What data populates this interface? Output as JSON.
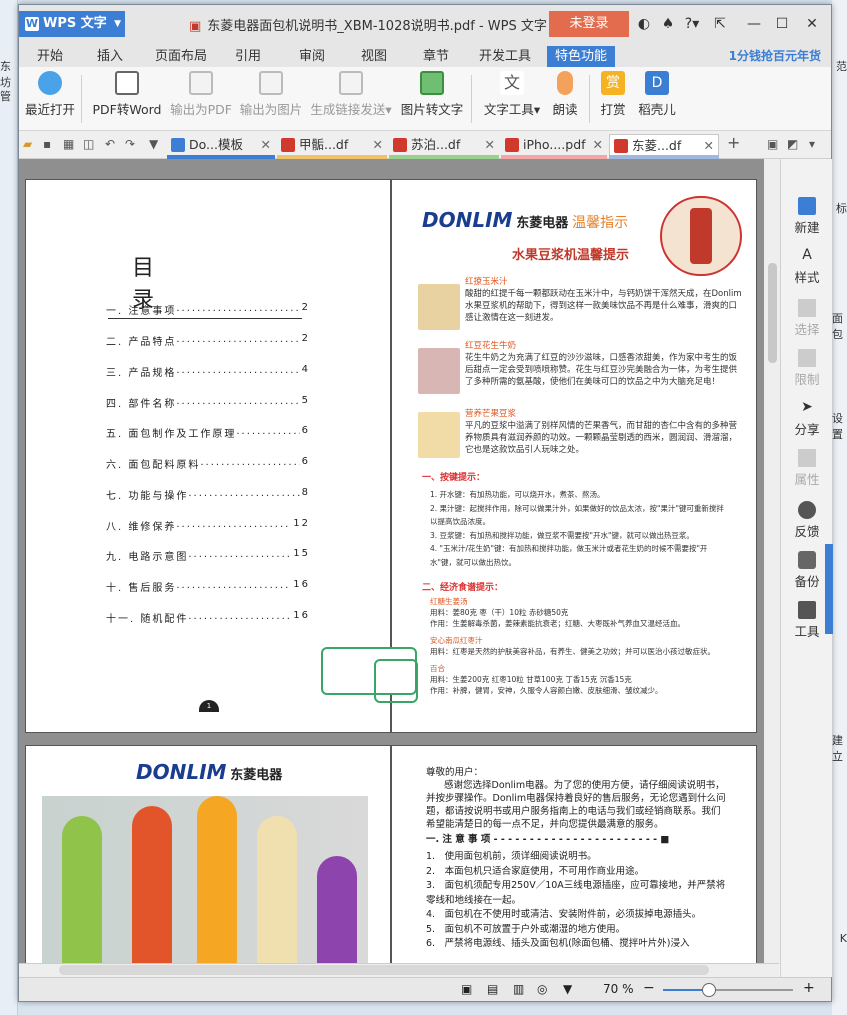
{
  "background": {
    "left_snippets": [
      "东坊",
      "管"
    ],
    "right_snippets": [
      "范",
      "标",
      "面包",
      "设置",
      "建立",
      "K"
    ]
  },
  "app": {
    "logo": "WPS 文字",
    "title": "东菱电器面包机说明书_XBM-1028说明书.pdf - WPS 文字",
    "login": "未登录",
    "help": "?"
  },
  "menu": {
    "items": [
      "开始",
      "插入",
      "页面布局",
      "引用",
      "审阅",
      "视图",
      "章节",
      "开发工具",
      "特色功能"
    ],
    "active": "特色功能",
    "promo": "1分钱抢百元年货"
  },
  "ribbon": {
    "buttons": [
      {
        "label": "最近打开",
        "icon": "cloud-icon",
        "enabled": true
      },
      {
        "label": "PDF转Word",
        "icon": "pdf-to-word-icon",
        "enabled": true
      },
      {
        "label": "输出为PDF",
        "icon": "export-pdf-icon",
        "enabled": false
      },
      {
        "label": "输出为图片",
        "icon": "export-image-icon",
        "enabled": false
      },
      {
        "label": "生成链接发送",
        "icon": "share-link-icon",
        "enabled": false
      },
      {
        "label": "图片转文字",
        "icon": "image-to-text-icon",
        "enabled": true
      },
      {
        "label": "文字工具",
        "icon": "text-tool-icon",
        "enabled": true
      },
      {
        "label": "朗读",
        "icon": "microphone-icon",
        "enabled": true
      },
      {
        "label": "打赏",
        "icon": "reward-icon",
        "enabled": true
      },
      {
        "label": "稻壳儿",
        "icon": "docer-icon",
        "enabled": true
      }
    ],
    "reward_glyph": "赏"
  },
  "tabs": {
    "items": [
      {
        "label": "Do...模板",
        "color": "#3b7ed4"
      },
      {
        "label": "甲骺...df",
        "color": "#f0c36b"
      },
      {
        "label": "苏泊...df",
        "color": "#9ad18f"
      },
      {
        "label": "iPho....pdf",
        "color": "#f2a6a6"
      },
      {
        "label": "东菱...df",
        "color": "#9fb8e0"
      }
    ],
    "active": 4,
    "add": "+"
  },
  "page_left_top": {
    "toc_title": "目　录",
    "toc": [
      {
        "num": "一.",
        "title": "注意事项",
        "page": "2"
      },
      {
        "num": "二.",
        "title": "产品特点",
        "page": "2"
      },
      {
        "num": "三.",
        "title": "产品规格",
        "page": "4"
      },
      {
        "num": "四.",
        "title": "部件名称",
        "page": "5"
      },
      {
        "num": "五.",
        "title": "面包制作及工作原理",
        "page": "6"
      },
      {
        "num": "六.",
        "title": "面包配料原料",
        "page": "6"
      },
      {
        "num": "七.",
        "title": "功能与操作",
        "page": "8"
      },
      {
        "num": "八.",
        "title": "维修保养",
        "page": "12"
      },
      {
        "num": "九.",
        "title": "电路示意图",
        "page": "15"
      },
      {
        "num": "十.",
        "title": "售后服务",
        "page": "16"
      },
      {
        "num": "十一.",
        "title": "随机配件",
        "page": "16"
      }
    ],
    "page_number": "1"
  },
  "page_right_top": {
    "brand": "DONLIM",
    "brand_cn": "东菱电器",
    "tagline": "温馨指示",
    "heading": "水果豆浆机温馨提示",
    "items": [
      {
        "title": "红撩玉米汁",
        "text": "酸甜的红提千每一颗都跃动在玉米汁中，与钙奶饼干浑然天成，在Donlim水果豆浆机的帮助下，得到这样一款美味饮品不再是什么难事，滑爽的口感让激情在这一刻进发。"
      },
      {
        "title": "红豆花生牛奶",
        "text": "花生牛奶之为充满了红豆的沙沙滋味，口感香浓甜美，作为家中考生的饭后甜点一定会受到喷喷称赞。花生与红豆沙完美融合为一体，为考生提供了多种所需的氨基酸，使他们在美味可口的饮品之中为大脑充足电！"
      },
      {
        "title": "营养芒果豆浆",
        "text": "平凡的豆浆中溢满了别样风情的芒果香气，而甘甜的杏仁中含有的多种营养物质具有滋润养颜的功效。一颗颗晶莹剔透的西米，圆润润、滑溜溜，它也是这款饮品引人玩味之处。"
      }
    ],
    "sec1": "一、按键提示：",
    "keys": [
      "1. 开水键：有加热功能，可以烧开水，煮茶、熬汤。",
      "2. 果汁键：起搅拌作用，除可以做果汁外，如果做好的饮品太浓，按\"果汁\"键可重新搅拌以提高饮品浓度。",
      "3. 豆浆键：有加热和搅拌功能，做豆浆不需要按\"开水\"键，就可以做出热豆浆。",
      "4. \"玉米汁/花生奶\"键：有加热和搅拌功能，做玉米汁或者花生奶的时候不需要按\"开水\"键，就可以做出热饮。"
    ],
    "sec2": "二、经济食谱提示：",
    "recipes": [
      {
        "title": "红糖生姜汤",
        "lines": [
          "用料：姜80克 枣（干）10粒 赤砂糖50克",
          "作用：生姜解毒杀菌，姜辣素能抗衰老；红糖、大枣既补气养血又温经活血。"
        ]
      },
      {
        "title": "安心南瓜红枣汁",
        "lines": [
          "用料：红枣是天然的护肤美容补品，有养生、健美之功效；并可以医治小孩过敏症状。"
        ]
      },
      {
        "title": "百合",
        "lines": [
          "用料：生姜200克 红枣10粒 甘草100克 丁香15克 沉香15克",
          "作用：补脾，健胃，安神，久服令人容颜白嫩、皮肤细滑、皱纹减少。"
        ]
      }
    ]
  },
  "page_left_bottom": {
    "brand": "DONLIM",
    "brand_cn": "东菱电器"
  },
  "page_right_bottom": {
    "greeting": "尊敬的用户：",
    "intro": "感谢您选择Donlim电器。为了您的使用方便，请仔细阅读说明书，并按步骤操作。Donlim电器保持着良好的售后服务，无论您遇到什么问题，都请按说明书或用户服务指南上的电话与我们或经销商联系。我们希望能清楚日的每一点不足，并向您提供最满意的服务。",
    "section": "一. 注 意 事 项",
    "items": [
      "1.　使用面包机前，须详细阅读说明书。",
      "2.　本面包机只适合家庭使用，不可用作商业用途。",
      "3.　面包机须配专用250V／10A三线电源插座，应可靠接地，并严禁将零线和地线接在一起。",
      "4.　面包机在不使用时或清洁、安装附件前，必须拔掉电源插头。",
      "5.　面包机不可放置于户外或潮湿的地方使用。",
      "6.　严禁将电源线、插头及面包机(除面包桶、搅拌叶片外)浸入"
    ]
  },
  "sidebar": {
    "items": [
      {
        "label": "新建",
        "icon": "new-doc-icon",
        "enabled": true
      },
      {
        "label": "样式",
        "icon": "style-icon",
        "enabled": true
      },
      {
        "label": "选择",
        "icon": "select-icon",
        "enabled": false
      },
      {
        "label": "限制",
        "icon": "restrict-icon",
        "enabled": false
      },
      {
        "label": "分享",
        "icon": "share-icon",
        "enabled": true
      },
      {
        "label": "属性",
        "icon": "properties-icon",
        "enabled": false
      },
      {
        "label": "反馈",
        "icon": "feedback-icon",
        "enabled": true
      },
      {
        "label": "备份",
        "icon": "backup-icon",
        "enabled": true
      },
      {
        "label": "工具",
        "icon": "toolbox-icon",
        "enabled": true
      }
    ]
  },
  "status": {
    "zoom": "70 %",
    "zoom_level": 0.35
  }
}
